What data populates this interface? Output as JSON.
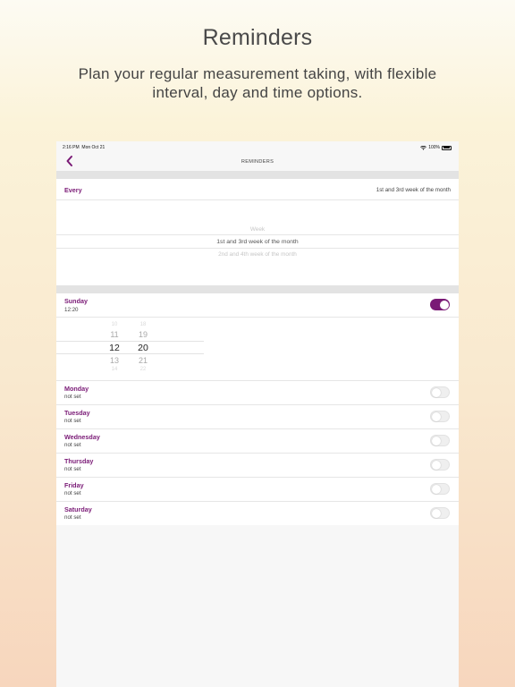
{
  "marketing": {
    "title": "Reminders",
    "subtitle": "Plan your regular measurement taking, with flexible interval, day and time options."
  },
  "status_bar": {
    "time": "2:16 PM",
    "date": "Mon Oct 21",
    "battery": "100%",
    "wifi_icon": "wifi-icon",
    "battery_icon": "battery-icon"
  },
  "nav": {
    "title": "REMINDERS",
    "back_icon": "chevron-left-icon"
  },
  "interval": {
    "label": "Every",
    "value": "1st and 3rd week of the month",
    "picker_options": [
      "Week",
      "1st and 3rd week of the month",
      "2nd and 4th week of the month"
    ],
    "selected_index": 1
  },
  "sunday": {
    "name": "Sunday",
    "time": "12:20",
    "enabled": true,
    "hour_options": [
      "10",
      "11",
      "12",
      "13",
      "14"
    ],
    "minute_options": [
      "18",
      "19",
      "20",
      "21",
      "22"
    ],
    "selected_hour": "12",
    "selected_minute": "20"
  },
  "days": [
    {
      "name": "Monday",
      "status": "not set",
      "enabled": false
    },
    {
      "name": "Tuesday",
      "status": "not set",
      "enabled": false
    },
    {
      "name": "Wednesday",
      "status": "not set",
      "enabled": false
    },
    {
      "name": "Thursday",
      "status": "not set",
      "enabled": false
    },
    {
      "name": "Friday",
      "status": "not set",
      "enabled": false
    },
    {
      "name": "Saturday",
      "status": "not set",
      "enabled": false
    }
  ],
  "colors": {
    "accent": "#7a1a76",
    "toggle_off": "#efefef"
  }
}
